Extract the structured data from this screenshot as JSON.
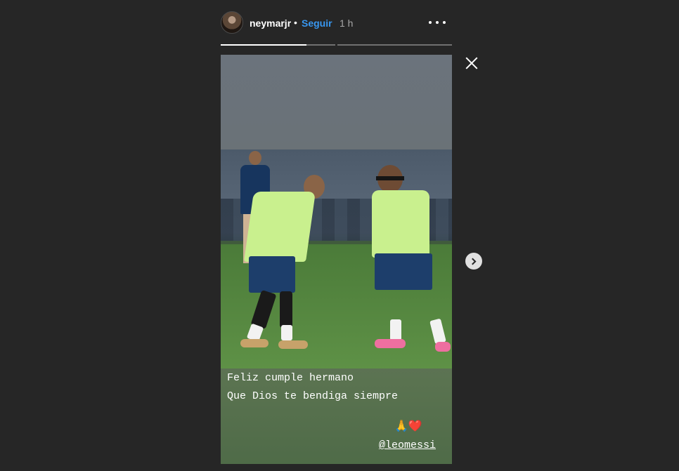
{
  "header": {
    "username": "neymarjr",
    "separator": "•",
    "follow_label": "Seguir",
    "time_ago": "1 h"
  },
  "progress": {
    "segments": 2,
    "current_segment_progress": 0.75
  },
  "story": {
    "caption_line1": "Feliz cumple hermano",
    "caption_line2": "Que Dios te bendiga siempre",
    "emoji": "🙏❤️",
    "mention": "@leomessi"
  },
  "icons": {
    "more": "more-horizontal-icon",
    "close": "close-icon",
    "next": "chevron-right-icon"
  },
  "colors": {
    "background": "#262626",
    "follow": "#3897f0"
  }
}
